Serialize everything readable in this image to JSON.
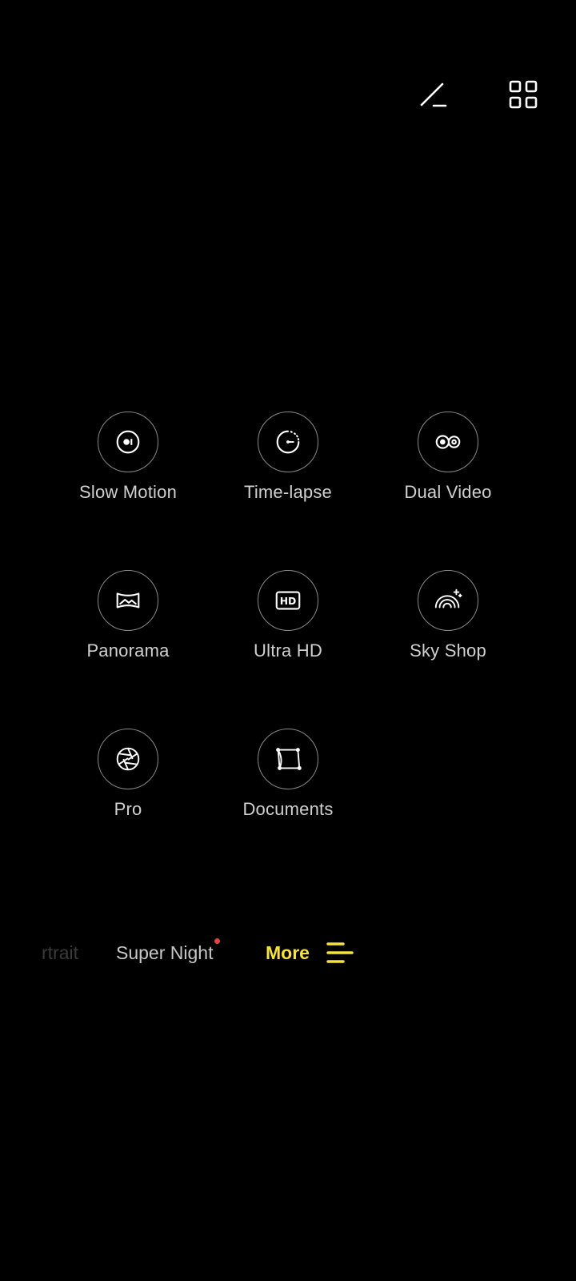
{
  "colors": {
    "background": "#000000",
    "accent": "#f6e23a",
    "notification": "#e0463c",
    "text": "#d0d0d0",
    "text_dim": "#3a3a3a"
  },
  "top_bar": {
    "icons": [
      "edit-icon",
      "grid-icon"
    ]
  },
  "modes": [
    {
      "label": "Slow Motion",
      "icon": "slow-motion-icon"
    },
    {
      "label": "Time-lapse",
      "icon": "time-lapse-icon"
    },
    {
      "label": "Dual Video",
      "icon": "dual-video-icon"
    },
    {
      "label": "Panorama",
      "icon": "panorama-icon"
    },
    {
      "label": "Ultra HD",
      "icon": "ultra-hd-icon"
    },
    {
      "label": "Sky Shop",
      "icon": "sky-shop-icon"
    },
    {
      "label": "Pro",
      "icon": "aperture-icon"
    },
    {
      "label": "Documents",
      "icon": "documents-icon"
    }
  ],
  "ultra_hd_badge": "HD",
  "mode_bar": {
    "portrait_partial": "rtrait",
    "super_night": "Super Night",
    "more": "More",
    "more_icon": "menu-icon"
  }
}
